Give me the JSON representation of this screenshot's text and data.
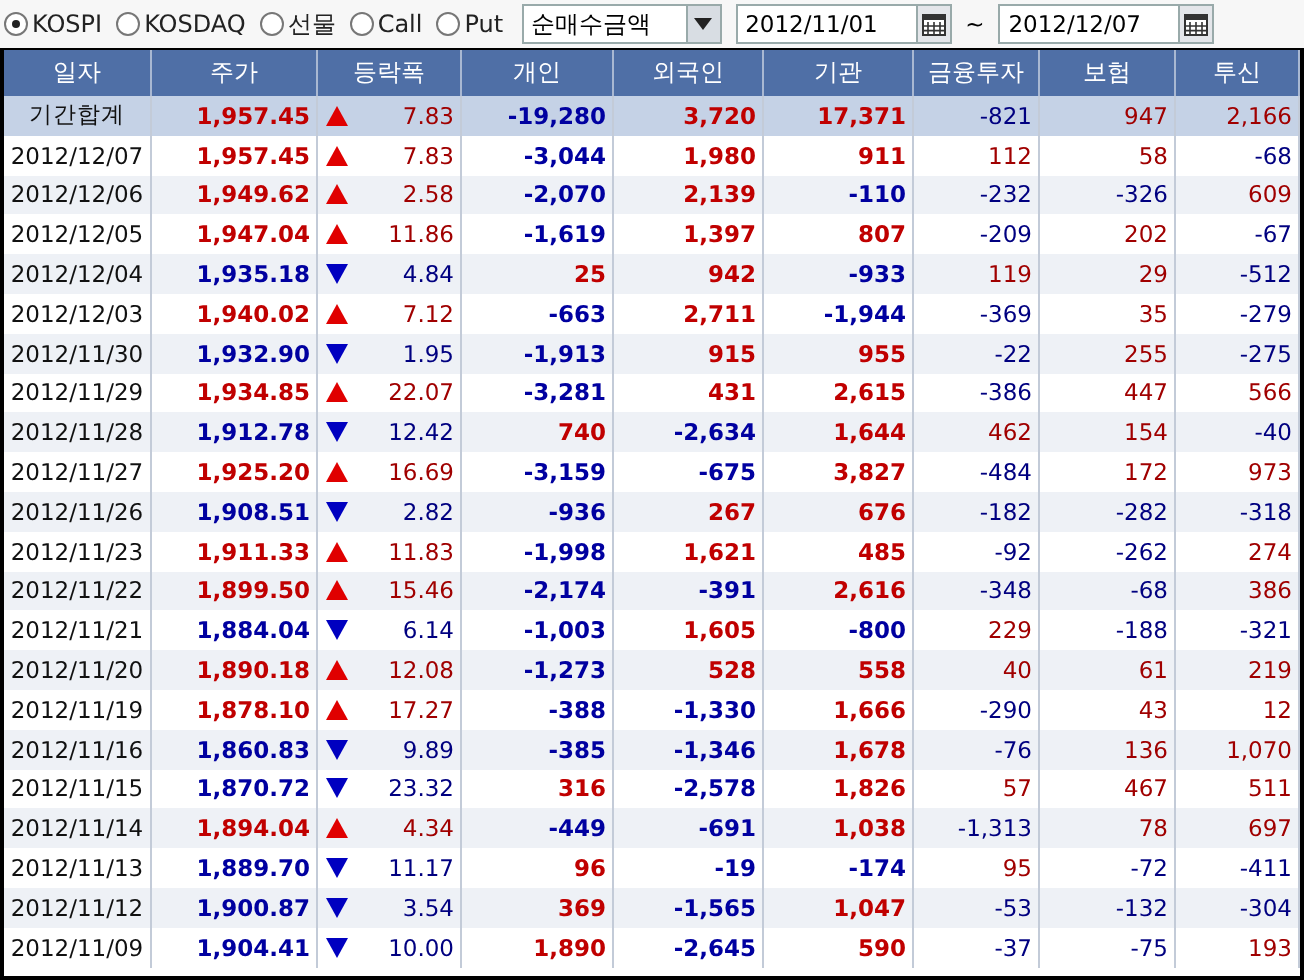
{
  "toolbar": {
    "markets": [
      {
        "label": "KOSPI",
        "selected": true
      },
      {
        "label": "KOSDAQ",
        "selected": false
      },
      {
        "label": "선물",
        "selected": false
      },
      {
        "label": "Call",
        "selected": false
      },
      {
        "label": "Put",
        "selected": false
      }
    ],
    "measure": "순매수금액",
    "date_from": "2012/11/01",
    "separator": "~",
    "date_to": "2012/12/07"
  },
  "table": {
    "columns": [
      "일자",
      "주가",
      "등락폭",
      "개인",
      "외국인",
      "기관",
      "금융투자",
      "보험",
      "투신"
    ],
    "rows": [
      {
        "kind": "total",
        "date": "기간합계",
        "price": "1,957.45",
        "rising": true,
        "change": "7.83",
        "individual": "-19,280",
        "foreign": "3,720",
        "institution": "17,371",
        "financial": "-821",
        "insurance": "947",
        "trust": "2,166"
      },
      {
        "kind": "day",
        "date": "2012/12/07",
        "price": "1,957.45",
        "rising": true,
        "change": "7.83",
        "individual": "-3,044",
        "foreign": "1,980",
        "institution": "911",
        "financial": "112",
        "insurance": "58",
        "trust": "-68"
      },
      {
        "kind": "day",
        "date": "2012/12/06",
        "price": "1,949.62",
        "rising": true,
        "change": "2.58",
        "individual": "-2,070",
        "foreign": "2,139",
        "institution": "-110",
        "financial": "-232",
        "insurance": "-326",
        "trust": "609"
      },
      {
        "kind": "day",
        "date": "2012/12/05",
        "price": "1,947.04",
        "rising": true,
        "change": "11.86",
        "individual": "-1,619",
        "foreign": "1,397",
        "institution": "807",
        "financial": "-209",
        "insurance": "202",
        "trust": "-67"
      },
      {
        "kind": "day",
        "date": "2012/12/04",
        "price": "1,935.18",
        "rising": false,
        "change": "4.84",
        "individual": "25",
        "foreign": "942",
        "institution": "-933",
        "financial": "119",
        "insurance": "29",
        "trust": "-512"
      },
      {
        "kind": "day",
        "date": "2012/12/03",
        "price": "1,940.02",
        "rising": true,
        "change": "7.12",
        "individual": "-663",
        "foreign": "2,711",
        "institution": "-1,944",
        "financial": "-369",
        "insurance": "35",
        "trust": "-279"
      },
      {
        "kind": "day",
        "date": "2012/11/30",
        "price": "1,932.90",
        "rising": false,
        "change": "1.95",
        "individual": "-1,913",
        "foreign": "915",
        "institution": "955",
        "financial": "-22",
        "insurance": "255",
        "trust": "-275"
      },
      {
        "kind": "day",
        "date": "2012/11/29",
        "price": "1,934.85",
        "rising": true,
        "change": "22.07",
        "individual": "-3,281",
        "foreign": "431",
        "institution": "2,615",
        "financial": "-386",
        "insurance": "447",
        "trust": "566"
      },
      {
        "kind": "day",
        "date": "2012/11/28",
        "price": "1,912.78",
        "rising": false,
        "change": "12.42",
        "individual": "740",
        "foreign": "-2,634",
        "institution": "1,644",
        "financial": "462",
        "insurance": "154",
        "trust": "-40"
      },
      {
        "kind": "day",
        "date": "2012/11/27",
        "price": "1,925.20",
        "rising": true,
        "change": "16.69",
        "individual": "-3,159",
        "foreign": "-675",
        "institution": "3,827",
        "financial": "-484",
        "insurance": "172",
        "trust": "973"
      },
      {
        "kind": "day",
        "date": "2012/11/26",
        "price": "1,908.51",
        "rising": false,
        "change": "2.82",
        "individual": "-936",
        "foreign": "267",
        "institution": "676",
        "financial": "-182",
        "insurance": "-282",
        "trust": "-318"
      },
      {
        "kind": "day",
        "date": "2012/11/23",
        "price": "1,911.33",
        "rising": true,
        "change": "11.83",
        "individual": "-1,998",
        "foreign": "1,621",
        "institution": "485",
        "financial": "-92",
        "insurance": "-262",
        "trust": "274"
      },
      {
        "kind": "day",
        "date": "2012/11/22",
        "price": "1,899.50",
        "rising": true,
        "change": "15.46",
        "individual": "-2,174",
        "foreign": "-391",
        "institution": "2,616",
        "financial": "-348",
        "insurance": "-68",
        "trust": "386"
      },
      {
        "kind": "day",
        "date": "2012/11/21",
        "price": "1,884.04",
        "rising": false,
        "change": "6.14",
        "individual": "-1,003",
        "foreign": "1,605",
        "institution": "-800",
        "financial": "229",
        "insurance": "-188",
        "trust": "-321"
      },
      {
        "kind": "day",
        "date": "2012/11/20",
        "price": "1,890.18",
        "rising": true,
        "change": "12.08",
        "individual": "-1,273",
        "foreign": "528",
        "institution": "558",
        "financial": "40",
        "insurance": "61",
        "trust": "219"
      },
      {
        "kind": "day",
        "date": "2012/11/19",
        "price": "1,878.10",
        "rising": true,
        "change": "17.27",
        "individual": "-388",
        "foreign": "-1,330",
        "institution": "1,666",
        "financial": "-290",
        "insurance": "43",
        "trust": "12"
      },
      {
        "kind": "day",
        "date": "2012/11/16",
        "price": "1,860.83",
        "rising": false,
        "change": "9.89",
        "individual": "-385",
        "foreign": "-1,346",
        "institution": "1,678",
        "financial": "-76",
        "insurance": "136",
        "trust": "1,070"
      },
      {
        "kind": "day",
        "date": "2012/11/15",
        "price": "1,870.72",
        "rising": false,
        "change": "23.32",
        "individual": "316",
        "foreign": "-2,578",
        "institution": "1,826",
        "financial": "57",
        "insurance": "467",
        "trust": "511"
      },
      {
        "kind": "day",
        "date": "2012/11/14",
        "price": "1,894.04",
        "rising": true,
        "change": "4.34",
        "individual": "-449",
        "foreign": "-691",
        "institution": "1,038",
        "financial": "-1,313",
        "insurance": "78",
        "trust": "697"
      },
      {
        "kind": "day",
        "date": "2012/11/13",
        "price": "1,889.70",
        "rising": false,
        "change": "11.17",
        "individual": "96",
        "foreign": "-19",
        "institution": "-174",
        "financial": "95",
        "insurance": "-72",
        "trust": "-411"
      },
      {
        "kind": "day",
        "date": "2012/11/12",
        "price": "1,900.87",
        "rising": false,
        "change": "3.54",
        "individual": "369",
        "foreign": "-1,565",
        "institution": "1,047",
        "financial": "-53",
        "insurance": "-132",
        "trust": "-304"
      },
      {
        "kind": "day",
        "date": "2012/11/09",
        "price": "1,904.41",
        "rising": false,
        "change": "10.00",
        "individual": "1,890",
        "foreign": "-2,645",
        "institution": "590",
        "financial": "-37",
        "insurance": "-75",
        "trust": "193"
      }
    ]
  }
}
